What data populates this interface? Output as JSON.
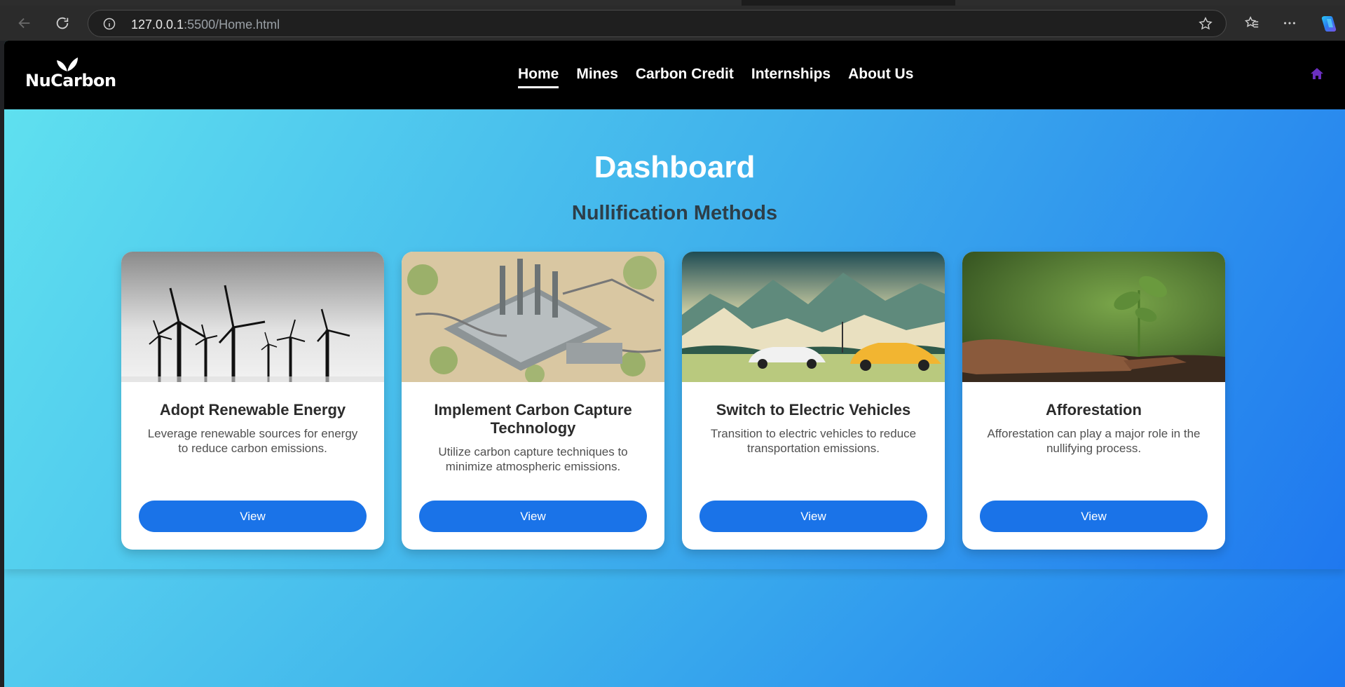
{
  "browser": {
    "url_host": "127.0.0.1",
    "url_path": ":5500/Home.html"
  },
  "site": {
    "logo_text": "NuCarbon",
    "nav": [
      {
        "label": "Home",
        "active": true
      },
      {
        "label": "Mines"
      },
      {
        "label": "Carbon Credit"
      },
      {
        "label": "Internships"
      },
      {
        "label": "About Us"
      }
    ]
  },
  "dashboard": {
    "title": "Dashboard",
    "subtitle": "Nullification Methods"
  },
  "cards": [
    {
      "title": "Adopt Renewable Energy",
      "text": "Leverage renewable sources for energy to reduce carbon emissions.",
      "button": "View",
      "image": "wind-turbines-image"
    },
    {
      "title": "Implement Carbon Capture Technology",
      "text": "Utilize carbon capture techniques to minimize atmospheric emissions.",
      "button": "View",
      "image": "carbon-capture-plant-image"
    },
    {
      "title": "Switch to Electric Vehicles",
      "text": "Transition to electric vehicles to reduce transportation emissions.",
      "button": "View",
      "image": "electric-cars-landscape-image"
    },
    {
      "title": "Afforestation",
      "text": "Afforestation can play a major role in the nullifying process.",
      "button": "View",
      "image": "hand-planting-seedling-image"
    }
  ],
  "colors": {
    "nav_bg": "#000000",
    "button": "#1a73e8",
    "home_icon": "#6b2fc0",
    "gradient_start": "#5fe0ef",
    "gradient_end": "#1f78ef"
  }
}
